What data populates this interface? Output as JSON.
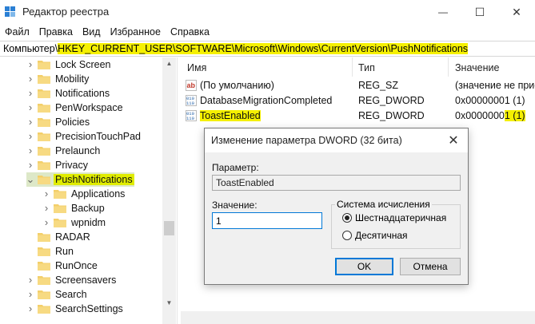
{
  "window": {
    "title": "Редактор реестра",
    "controls": {
      "minimize": "—",
      "maximize": "☐",
      "close": "✕"
    }
  },
  "menu": [
    "Файл",
    "Правка",
    "Вид",
    "Избранное",
    "Справка"
  ],
  "address": {
    "prefix": "Компьютер\\",
    "path": "HKEY_CURRENT_USER\\SOFTWARE\\Microsoft\\Windows\\CurrentVersion\\PushNotifications"
  },
  "tree": {
    "items": [
      {
        "label": "Lock Screen",
        "expandable": true,
        "selected": false,
        "level": 0
      },
      {
        "label": "Mobility",
        "expandable": true,
        "selected": false,
        "level": 0
      },
      {
        "label": "Notifications",
        "expandable": true,
        "selected": false,
        "level": 0
      },
      {
        "label": "PenWorkspace",
        "expandable": true,
        "selected": false,
        "level": 0
      },
      {
        "label": "Policies",
        "expandable": true,
        "selected": false,
        "level": 0
      },
      {
        "label": "PrecisionTouchPad",
        "expandable": true,
        "selected": false,
        "level": 0
      },
      {
        "label": "Prelaunch",
        "expandable": true,
        "selected": false,
        "level": 0
      },
      {
        "label": "Privacy",
        "expandable": true,
        "selected": false,
        "level": 0
      },
      {
        "label": "PushNotifications",
        "expandable": true,
        "expanded": true,
        "selected": true,
        "level": 0
      },
      {
        "label": "Applications",
        "expandable": true,
        "selected": false,
        "level": 1
      },
      {
        "label": "Backup",
        "expandable": true,
        "selected": false,
        "level": 1
      },
      {
        "label": "wpnidm",
        "expandable": true,
        "selected": false,
        "level": 1
      },
      {
        "label": "RADAR",
        "expandable": false,
        "selected": false,
        "level": 0
      },
      {
        "label": "Run",
        "expandable": false,
        "selected": false,
        "level": 0
      },
      {
        "label": "RunOnce",
        "expandable": false,
        "selected": false,
        "level": 0
      },
      {
        "label": "Screensavers",
        "expandable": true,
        "selected": false,
        "level": 0
      },
      {
        "label": "Search",
        "expandable": true,
        "selected": false,
        "level": 0
      },
      {
        "label": "SearchSettings",
        "expandable": true,
        "selected": false,
        "level": 0
      }
    ]
  },
  "list": {
    "columns": {
      "name": "Имя",
      "type": "Тип",
      "value": "Значение"
    },
    "rows": [
      {
        "icon": "string-value-icon",
        "name": "(По умолчанию)",
        "type": "REG_SZ",
        "value": "(значение не присвоено)",
        "highlight_name": false
      },
      {
        "icon": "dword-value-icon",
        "name": "DatabaseMigrationCompleted",
        "type": "REG_DWORD",
        "value": "0x00000001 (1)",
        "highlight_name": false
      },
      {
        "icon": "dword-value-icon",
        "name": "ToastEnabled",
        "type": "REG_DWORD",
        "value": "0x00000001 (1)",
        "value_plain": "0x0000000",
        "value_highlight": "1 (1)",
        "highlight_name": true
      }
    ]
  },
  "dialog": {
    "title": "Изменение параметра DWORD (32 бита)",
    "close": "✕",
    "param_label": "Параметр:",
    "param_value": "ToastEnabled",
    "value_label": "Значение:",
    "value_input": "1",
    "base_label": "Система исчисления",
    "base_options": [
      {
        "label": "Шестнадцатеричная",
        "checked": true
      },
      {
        "label": "Десятичная",
        "checked": false
      }
    ],
    "ok": "OK",
    "cancel": "Отмена"
  },
  "colors": {
    "highlight_yellow": "#f5f000",
    "accent_blue": "#0078d7",
    "dialog_bg": "#f0f0f0"
  }
}
